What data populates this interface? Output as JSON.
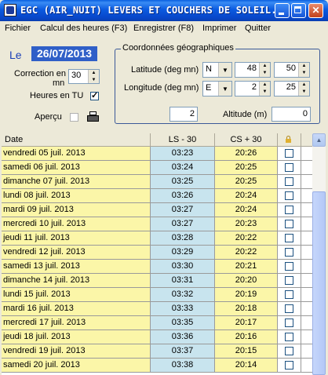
{
  "window": {
    "title": "EGC  (AIR_NUIT) LEVERS ET COUCHERS DE SOLEIL..."
  },
  "menu": [
    "Fichier",
    "Calcul des heures (F3)",
    "Enregistrer (F8)",
    "Imprimer",
    "Quitter"
  ],
  "form": {
    "le_label": "Le",
    "date": "26/07/2013",
    "correction_label1": "Correction en",
    "correction_label2": "mn",
    "correction_value": "30",
    "heures_tu_label": "Heures en TU",
    "heures_tu_checked": true,
    "apercu_label": "Aperçu",
    "apercu_checked": false,
    "printer_icon": "printer-icon"
  },
  "coords": {
    "group_title": "Coordonnées géographiques",
    "latitude_label": "Latitude (deg mn)",
    "lat_dir": "N",
    "lat_deg": "48",
    "lat_min": "50",
    "longitude_label": "Longitude (deg mn)",
    "lon_dir": "E",
    "lon_deg": "2",
    "lon_min": "25",
    "unknown_value": "2",
    "altitude_label": "Altitude (m)",
    "altitude_value": "0"
  },
  "table": {
    "headers": {
      "date": "Date",
      "ls": "LS - 30",
      "cs": "CS + 30",
      "lock_icon": "lock-icon"
    },
    "rows": [
      {
        "date": "vendredi 05 juil. 2013",
        "ls": "03:23",
        "cs": "20:26",
        "checked": false
      },
      {
        "date": "samedi 06 juil. 2013",
        "ls": "03:24",
        "cs": "20:25",
        "checked": false
      },
      {
        "date": "dimanche 07 juil. 2013",
        "ls": "03:25",
        "cs": "20:25",
        "checked": false
      },
      {
        "date": "lundi 08 juil. 2013",
        "ls": "03:26",
        "cs": "20:24",
        "checked": false
      },
      {
        "date": "mardi 09 juil. 2013",
        "ls": "03:27",
        "cs": "20:24",
        "checked": false
      },
      {
        "date": "mercredi 10 juil. 2013",
        "ls": "03:27",
        "cs": "20:23",
        "checked": false
      },
      {
        "date": "jeudi 11 juil. 2013",
        "ls": "03:28",
        "cs": "20:22",
        "checked": false
      },
      {
        "date": "vendredi 12 juil. 2013",
        "ls": "03:29",
        "cs": "20:22",
        "checked": false
      },
      {
        "date": "samedi 13 juil. 2013",
        "ls": "03:30",
        "cs": "20:21",
        "checked": false
      },
      {
        "date": "dimanche 14 juil. 2013",
        "ls": "03:31",
        "cs": "20:20",
        "checked": false
      },
      {
        "date": "lundi 15 juil. 2013",
        "ls": "03:32",
        "cs": "20:19",
        "checked": false
      },
      {
        "date": "mardi 16 juil. 2013",
        "ls": "03:33",
        "cs": "20:18",
        "checked": false
      },
      {
        "date": "mercredi 17 juil. 2013",
        "ls": "03:35",
        "cs": "20:17",
        "checked": false
      },
      {
        "date": "jeudi 18 juil. 2013",
        "ls": "03:36",
        "cs": "20:16",
        "checked": false
      },
      {
        "date": "vendredi 19 juil. 2013",
        "ls": "03:37",
        "cs": "20:15",
        "checked": false
      },
      {
        "date": "samedi 20 juil. 2013",
        "ls": "03:38",
        "cs": "20:14",
        "checked": false
      }
    ]
  },
  "colors": {
    "date_col": "#fbf6a8",
    "ls_col": "#c8e4ee",
    "titlebar": "#0a5ae0",
    "date_field": "#2f5fc8"
  }
}
